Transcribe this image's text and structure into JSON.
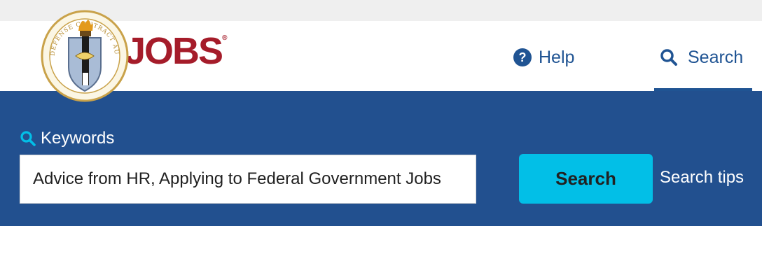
{
  "header": {
    "brand": "JOBS",
    "brand_mark": "®",
    "seal_text": "DEFENSE CONTRACT AUDIT AGENCY",
    "nav": {
      "help_label": "Help",
      "search_label": "Search"
    }
  },
  "search_form": {
    "keywords_label": "Keywords",
    "keywords_value": "Advice from HR, Applying to Federal Government Jobs",
    "search_button": "Search",
    "search_tips": "Search tips"
  },
  "colors": {
    "brand_red": "#a51c2a",
    "primary_blue": "#205493",
    "band_blue": "#22508f",
    "accent_cyan": "#02bfe7"
  },
  "icons": [
    "help-icon",
    "search-icon",
    "keywords-search-icon"
  ]
}
